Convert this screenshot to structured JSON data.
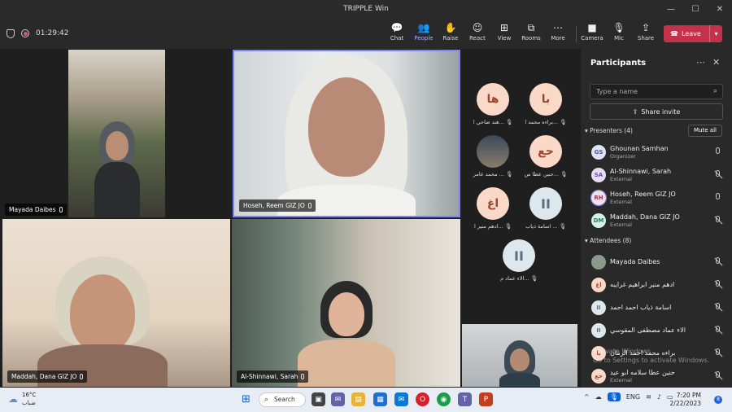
{
  "window": {
    "title": "TRIPPLE Win"
  },
  "meeting": {
    "timer": "01:29:42"
  },
  "toolbar": {
    "chat": "Chat",
    "people": "People",
    "raise": "Raise",
    "react": "React",
    "view": "View",
    "rooms": "Rooms",
    "more": "More",
    "camera": "Camera",
    "mic": "Mic",
    "share": "Share",
    "leave": "Leave"
  },
  "tiles": [
    {
      "name": "Mayada Daibes"
    },
    {
      "name": "Hoseh, Reem GIZ JO"
    },
    {
      "name": "Maddah, Dana GIZ JO"
    },
    {
      "name": "Al-Shinnawi, Sarah"
    }
  ],
  "avatars": [
    {
      "initials": "با",
      "label": "براءه محمد ا..."
    },
    {
      "initials": "ها",
      "label": "هند ضاحي ا..."
    },
    {
      "initials": "حع",
      "label": "حنين عطا س..."
    },
    {
      "initials": "",
      "label": "محمد عامر ..."
    },
    {
      "initials": "II",
      "label": "اسامة ذياب ..."
    },
    {
      "initials": "اغ",
      "label": "ادهم منير ا..."
    },
    {
      "initials": "II",
      "label": "الاء عماد م..."
    }
  ],
  "panel": {
    "title": "Participants",
    "search_placeholder": "Type a name",
    "share_invite": "Share invite",
    "presenters_label": "Presenters (4)",
    "mute_all": "Mute all",
    "attendees_label": "Attendees (8)",
    "presenters": [
      {
        "initials": "GS",
        "name": "Ghounan Samhan",
        "role": "Organizer",
        "bg": "#dfe3f3",
        "fg": "#4b5a9c"
      },
      {
        "initials": "SA",
        "name": "Al-Shinnawi, Sarah",
        "role": "External",
        "bg": "#e6dff3",
        "fg": "#6b4fa0"
      },
      {
        "initials": "RH",
        "name": "Hoseh, Reem GIZ JO",
        "role": "External",
        "bg": "#f3dfe6",
        "fg": "#9c3a5a"
      },
      {
        "initials": "DM",
        "name": "Maddah, Dana GIZ JO",
        "role": "External",
        "bg": "#d9efe9",
        "fg": "#2e7a66"
      }
    ],
    "attendees": [
      {
        "initials": "",
        "name": "Mayada Daibes",
        "role": "",
        "bg": "#8a9a8a",
        "fg": "#fff"
      },
      {
        "initials": "اغ",
        "name": "ادهم منير ابراهيم غرايبه",
        "role": "",
        "bg": "#fbd9c9",
        "fg": "#a0452a"
      },
      {
        "initials": "II",
        "name": "اسامة ذياب احمد احمد",
        "role": "",
        "bg": "#dde8ee",
        "fg": "#5a7080"
      },
      {
        "initials": "II",
        "name": "الاء عماد مصطفى المقوسي",
        "role": "",
        "bg": "#dde8ee",
        "fg": "#5a7080"
      },
      {
        "initials": "با",
        "name": "براءه محمد احمد الرمان",
        "role": "",
        "bg": "#fbd9c9",
        "fg": "#a0452a"
      },
      {
        "initials": "حع",
        "name": "حنين عطا سلامه ابو عيد",
        "role": "External",
        "bg": "#fbd9c9",
        "fg": "#a0452a"
      }
    ]
  },
  "watermark": {
    "line1": "Activate Windows",
    "line2": "Go to Settings to activate Windows."
  },
  "taskbar": {
    "temp": "16°C",
    "weather_text": "ضباب",
    "search": "Search",
    "lang": "ENG",
    "time": "7:20 PM",
    "date": "2/22/2023",
    "notif": "8"
  }
}
